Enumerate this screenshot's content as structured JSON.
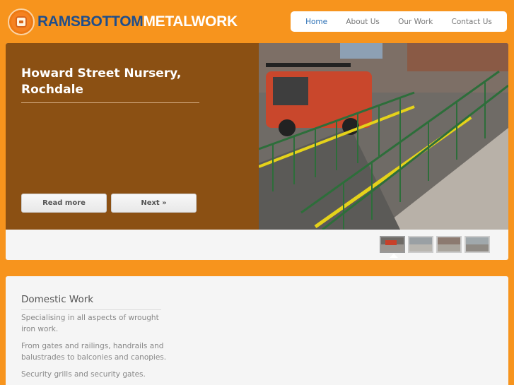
{
  "brand": {
    "name_part1": "RAMSBOTTOM",
    "name_part2": "METALWORK"
  },
  "nav": {
    "items": [
      "Home",
      "About Us",
      "Our Work",
      "Contact Us"
    ],
    "active": "Home"
  },
  "slider": {
    "title": "Howard Street Nursery, Rochdale",
    "read_more_label": "Read more",
    "next_label": "Next »",
    "thumbnail_count": 4,
    "active_thumbnail": 1
  },
  "content": {
    "heading": "Domestic Work",
    "paragraphs": [
      "Specialising in all aspects of wrought iron work.",
      "From gates and railings, handrails and balustrades to balconies and canopies.",
      "Security grills and security gates."
    ]
  },
  "colors": {
    "background": "#f7941d",
    "slide_panel": "#8b5013",
    "brand_blue": "#1f4e8c",
    "link_active": "#2a6fb5"
  }
}
